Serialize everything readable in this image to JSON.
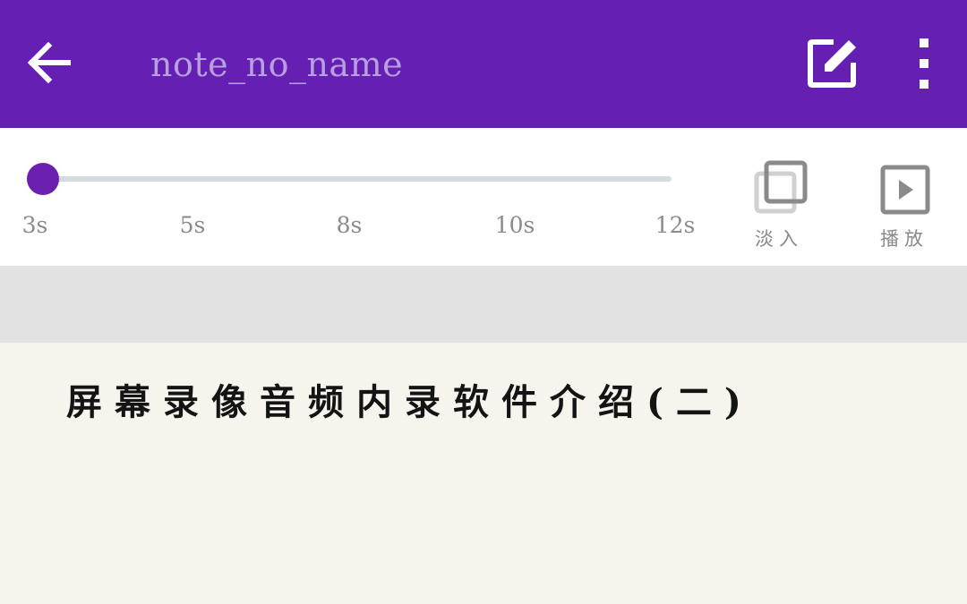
{
  "app_bar": {
    "title": "note_no_name",
    "back_icon": "arrow-left-icon",
    "edit_icon": "edit-square-icon",
    "more_icon": "more-vertical-icon",
    "background_color": "#651fb2"
  },
  "timeline": {
    "ticks": [
      "3s",
      "5s",
      "8s",
      "10s",
      "12s"
    ],
    "current_value": "3s",
    "accent_color": "#6a1fb0"
  },
  "tools": {
    "fade_in_label": "淡入",
    "fade_in_icon": "fade-in-icon",
    "play_label": "播放",
    "play_icon": "play-icon"
  },
  "note": {
    "text": "屏幕录像音频内录软件介绍(二)"
  }
}
